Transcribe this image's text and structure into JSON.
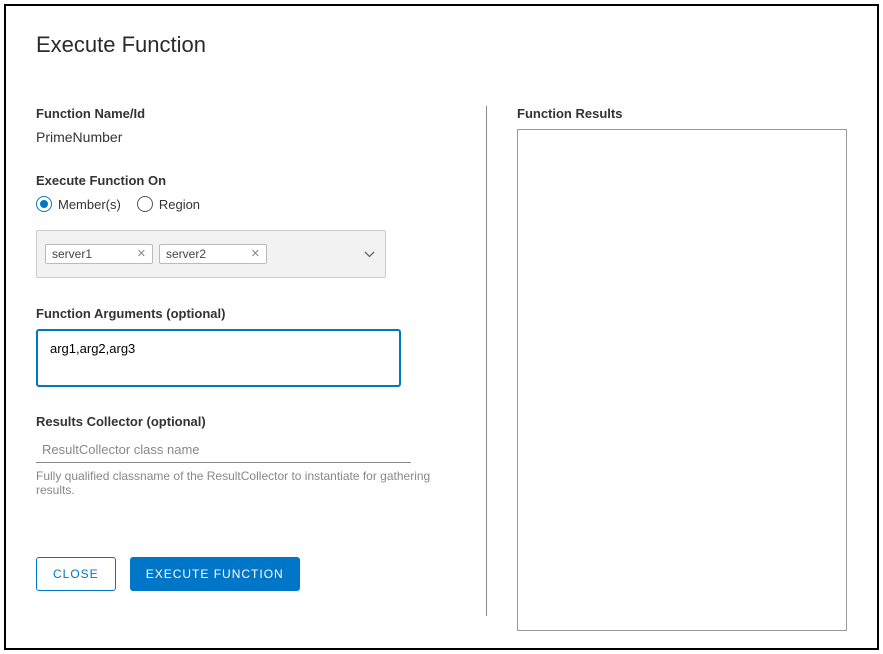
{
  "title": "Execute Function",
  "left": {
    "name_label": "Function Name/Id",
    "name_value": "PrimeNumber",
    "execute_on_label": "Execute Function On",
    "radios": {
      "members": "Member(s)",
      "region": "Region"
    },
    "chips": [
      "server1",
      "server2"
    ],
    "args_label": "Function Arguments (optional)",
    "args_value": "arg1,arg2,arg3",
    "collector_label": "Results Collector (optional)",
    "collector_placeholder": "ResultCollector class name",
    "collector_hint": "Fully qualified classname of the ResultCollector to instantiate for gathering results.",
    "close_btn": "CLOSE",
    "execute_btn": "EXECUTE FUNCTION"
  },
  "right": {
    "results_label": "Function Results"
  }
}
